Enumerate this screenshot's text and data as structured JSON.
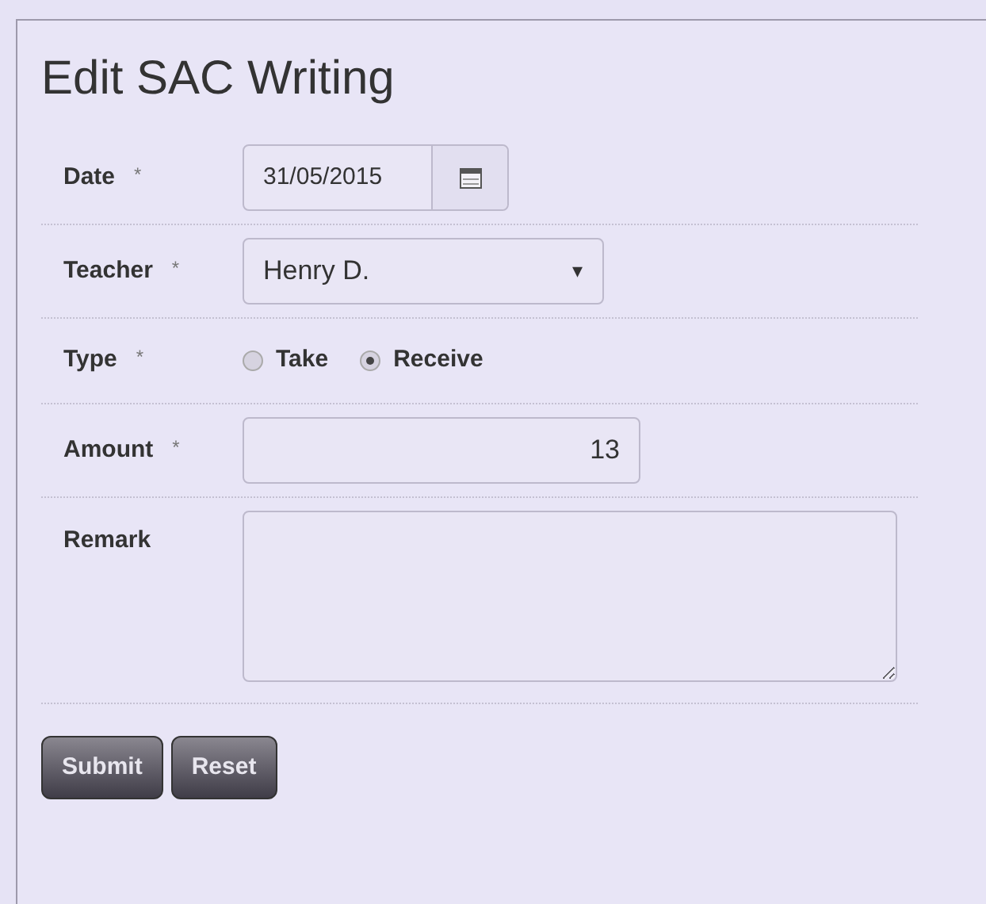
{
  "title": "Edit SAC Writing",
  "fields": [
    {
      "kind": "date",
      "label": "Date",
      "marker": "*",
      "value": "31/05/2015"
    },
    {
      "kind": "select",
      "label": "Teacher",
      "marker": "*",
      "value": "Henry D.",
      "caret": "▾"
    },
    {
      "kind": "radio",
      "label": "Type",
      "marker": "*",
      "options": [
        {
          "label": "Take",
          "selected": false
        },
        {
          "label": "Receive",
          "selected": true
        }
      ]
    },
    {
      "kind": "number",
      "label": "Amount",
      "marker": "*",
      "value": "13"
    },
    {
      "kind": "textarea",
      "label": "Remark"
    }
  ],
  "buttons": [
    "Submit",
    "Reset"
  ]
}
